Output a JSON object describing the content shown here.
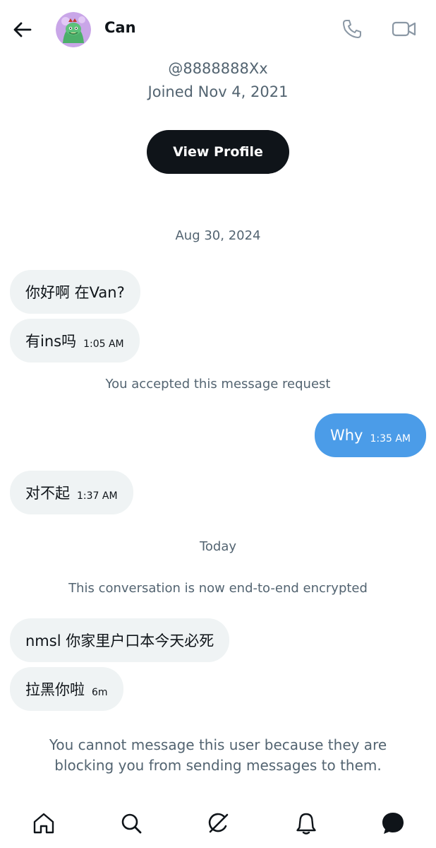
{
  "header": {
    "name": "Can",
    "icons": {
      "back": "arrow-left-icon",
      "call": "phone-icon",
      "video": "video-camera-icon"
    }
  },
  "profile": {
    "handle": "@8888888Xx",
    "joined": "Joined Nov 4, 2021",
    "view_profile_label": "View Profile"
  },
  "conversation": {
    "date_1": "Aug 30, 2024",
    "messages_1": [
      {
        "text": "你好啊 在Van?",
        "time": ""
      },
      {
        "text": "有ins吗",
        "time": "1:05 AM"
      }
    ],
    "accepted_notice": "You accepted this message request",
    "my_message": {
      "text": "Why",
      "time": "1:35 AM"
    },
    "reply": {
      "text": "对不起",
      "time": "1:37 AM"
    },
    "date_2": "Today",
    "encrypted_notice": "This conversation is now end-to-end encrypted",
    "messages_2": [
      {
        "text": "nmsl 你家里户口本今天必死",
        "time": ""
      },
      {
        "text": "拉黑你啦",
        "time": "6m"
      }
    ],
    "blocked_notice": "You cannot message this user because they are blocking you from sending messages to them."
  },
  "nav": {
    "items": [
      "home-icon",
      "search-icon",
      "grok-icon",
      "notifications-bell-icon",
      "messages-icon"
    ]
  },
  "colors": {
    "text_primary": "#0f1419",
    "text_secondary": "#536471",
    "bubble_other": "#eff3f4",
    "bubble_me": "#4b9ce8",
    "button_dark": "#0f1419"
  }
}
